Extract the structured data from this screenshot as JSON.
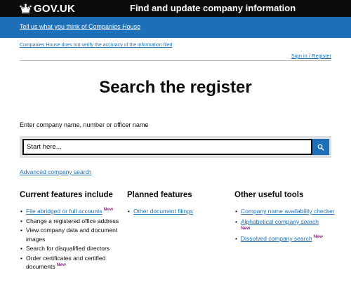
{
  "header": {
    "logo_text": "GOV.UK",
    "service_name": "Find and update company information",
    "crown_icon": "crown-icon"
  },
  "banner": {
    "feedback_link": "Tell us what you think of Companies House"
  },
  "notices": {
    "accuracy_link": "Companies House does not verify the accuracy of the information filed",
    "signin_link": "Sign in / Register"
  },
  "main": {
    "title": "Search the register",
    "search": {
      "label": "Enter company name, number or officer name",
      "placeholder": "Start here...",
      "button_icon": "search-icon"
    },
    "advanced_link": "Advanced company search"
  },
  "features": {
    "current": {
      "heading": "Current features include",
      "items": [
        {
          "text": "File abridged or full accounts",
          "link": true,
          "new": "New"
        },
        {
          "text": "Change a registered office address",
          "link": false,
          "new": ""
        },
        {
          "text": "View company data and document images",
          "link": false,
          "new": ""
        },
        {
          "text": "Search for disqualified directors",
          "link": false,
          "new": ""
        },
        {
          "text": "Order certificates and certified documents",
          "link": false,
          "new": "New"
        }
      ]
    },
    "planned": {
      "heading": "Planned features",
      "items": [
        {
          "text": "Other document filings",
          "link": true,
          "new": ""
        }
      ]
    },
    "tools": {
      "heading": "Other useful tools",
      "items": [
        {
          "text": "Company name availability checker",
          "link": true,
          "new": ""
        },
        {
          "text": "Alphabetical company search",
          "link": true,
          "new": "New"
        },
        {
          "text": "Dissolved company search",
          "link": true,
          "new": "New"
        }
      ]
    }
  },
  "colors": {
    "header_bg": "#0b0c0c",
    "banner_bg": "#1d70b8",
    "link": "#1d70b8",
    "new_tag": "#912b88"
  }
}
